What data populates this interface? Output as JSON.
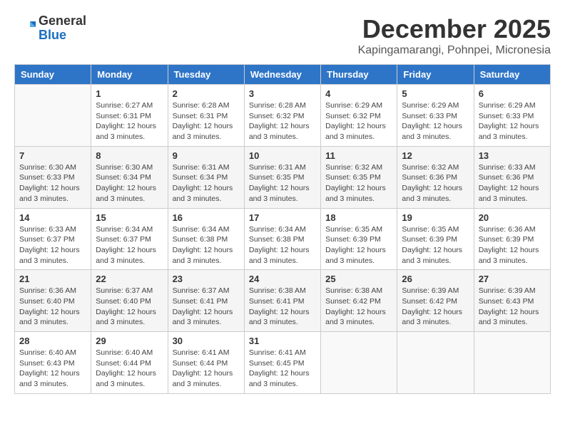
{
  "logo": {
    "general": "General",
    "blue": "Blue"
  },
  "title": "December 2025",
  "location": "Kapingamarangi, Pohnpei, Micronesia",
  "headers": [
    "Sunday",
    "Monday",
    "Tuesday",
    "Wednesday",
    "Thursday",
    "Friday",
    "Saturday"
  ],
  "weeks": [
    [
      {
        "day": "",
        "info": ""
      },
      {
        "day": "1",
        "info": "Sunrise: 6:27 AM\nSunset: 6:31 PM\nDaylight: 12 hours\nand 3 minutes."
      },
      {
        "day": "2",
        "info": "Sunrise: 6:28 AM\nSunset: 6:31 PM\nDaylight: 12 hours\nand 3 minutes."
      },
      {
        "day": "3",
        "info": "Sunrise: 6:28 AM\nSunset: 6:32 PM\nDaylight: 12 hours\nand 3 minutes."
      },
      {
        "day": "4",
        "info": "Sunrise: 6:29 AM\nSunset: 6:32 PM\nDaylight: 12 hours\nand 3 minutes."
      },
      {
        "day": "5",
        "info": "Sunrise: 6:29 AM\nSunset: 6:33 PM\nDaylight: 12 hours\nand 3 minutes."
      },
      {
        "day": "6",
        "info": "Sunrise: 6:29 AM\nSunset: 6:33 PM\nDaylight: 12 hours\nand 3 minutes."
      }
    ],
    [
      {
        "day": "7",
        "info": "Sunrise: 6:30 AM\nSunset: 6:33 PM\nDaylight: 12 hours\nand 3 minutes."
      },
      {
        "day": "8",
        "info": "Sunrise: 6:30 AM\nSunset: 6:34 PM\nDaylight: 12 hours\nand 3 minutes."
      },
      {
        "day": "9",
        "info": "Sunrise: 6:31 AM\nSunset: 6:34 PM\nDaylight: 12 hours\nand 3 minutes."
      },
      {
        "day": "10",
        "info": "Sunrise: 6:31 AM\nSunset: 6:35 PM\nDaylight: 12 hours\nand 3 minutes."
      },
      {
        "day": "11",
        "info": "Sunrise: 6:32 AM\nSunset: 6:35 PM\nDaylight: 12 hours\nand 3 minutes."
      },
      {
        "day": "12",
        "info": "Sunrise: 6:32 AM\nSunset: 6:36 PM\nDaylight: 12 hours\nand 3 minutes."
      },
      {
        "day": "13",
        "info": "Sunrise: 6:33 AM\nSunset: 6:36 PM\nDaylight: 12 hours\nand 3 minutes."
      }
    ],
    [
      {
        "day": "14",
        "info": "Sunrise: 6:33 AM\nSunset: 6:37 PM\nDaylight: 12 hours\nand 3 minutes."
      },
      {
        "day": "15",
        "info": "Sunrise: 6:34 AM\nSunset: 6:37 PM\nDaylight: 12 hours\nand 3 minutes."
      },
      {
        "day": "16",
        "info": "Sunrise: 6:34 AM\nSunset: 6:38 PM\nDaylight: 12 hours\nand 3 minutes."
      },
      {
        "day": "17",
        "info": "Sunrise: 6:34 AM\nSunset: 6:38 PM\nDaylight: 12 hours\nand 3 minutes."
      },
      {
        "day": "18",
        "info": "Sunrise: 6:35 AM\nSunset: 6:39 PM\nDaylight: 12 hours\nand 3 minutes."
      },
      {
        "day": "19",
        "info": "Sunrise: 6:35 AM\nSunset: 6:39 PM\nDaylight: 12 hours\nand 3 minutes."
      },
      {
        "day": "20",
        "info": "Sunrise: 6:36 AM\nSunset: 6:39 PM\nDaylight: 12 hours\nand 3 minutes."
      }
    ],
    [
      {
        "day": "21",
        "info": "Sunrise: 6:36 AM\nSunset: 6:40 PM\nDaylight: 12 hours\nand 3 minutes."
      },
      {
        "day": "22",
        "info": "Sunrise: 6:37 AM\nSunset: 6:40 PM\nDaylight: 12 hours\nand 3 minutes."
      },
      {
        "day": "23",
        "info": "Sunrise: 6:37 AM\nSunset: 6:41 PM\nDaylight: 12 hours\nand 3 minutes."
      },
      {
        "day": "24",
        "info": "Sunrise: 6:38 AM\nSunset: 6:41 PM\nDaylight: 12 hours\nand 3 minutes."
      },
      {
        "day": "25",
        "info": "Sunrise: 6:38 AM\nSunset: 6:42 PM\nDaylight: 12 hours\nand 3 minutes."
      },
      {
        "day": "26",
        "info": "Sunrise: 6:39 AM\nSunset: 6:42 PM\nDaylight: 12 hours\nand 3 minutes."
      },
      {
        "day": "27",
        "info": "Sunrise: 6:39 AM\nSunset: 6:43 PM\nDaylight: 12 hours\nand 3 minutes."
      }
    ],
    [
      {
        "day": "28",
        "info": "Sunrise: 6:40 AM\nSunset: 6:43 PM\nDaylight: 12 hours\nand 3 minutes."
      },
      {
        "day": "29",
        "info": "Sunrise: 6:40 AM\nSunset: 6:44 PM\nDaylight: 12 hours\nand 3 minutes."
      },
      {
        "day": "30",
        "info": "Sunrise: 6:41 AM\nSunset: 6:44 PM\nDaylight: 12 hours\nand 3 minutes."
      },
      {
        "day": "31",
        "info": "Sunrise: 6:41 AM\nSunset: 6:45 PM\nDaylight: 12 hours\nand 3 minutes."
      },
      {
        "day": "",
        "info": ""
      },
      {
        "day": "",
        "info": ""
      },
      {
        "day": "",
        "info": ""
      }
    ]
  ]
}
